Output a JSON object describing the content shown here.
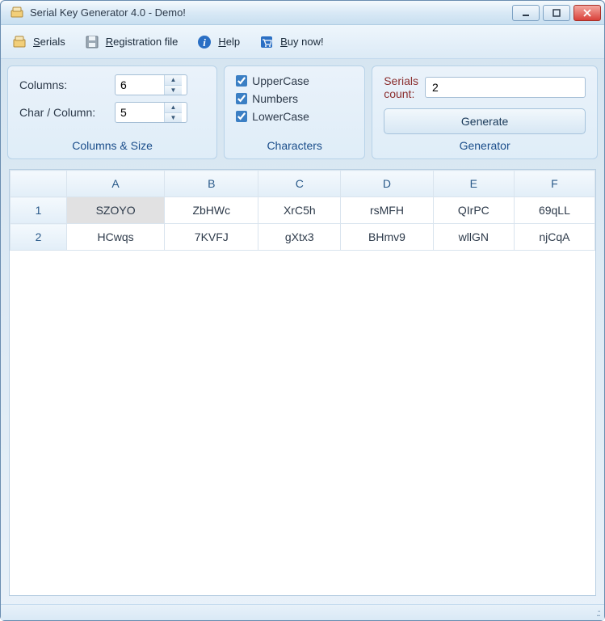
{
  "window": {
    "title": "Serial Key Generator 4.0 - Demo!"
  },
  "menu": {
    "serials": "Serials",
    "regfile": "Registration file",
    "help": "Help",
    "buynow": "Buy now!"
  },
  "panels": {
    "columns_label": "Columns:",
    "columns_value": "6",
    "charcol_label": "Char / Column:",
    "charcol_value": "5",
    "columns_size_caption": "Columns & Size",
    "uppercase": "UpperCase",
    "numbers": "Numbers",
    "lowercase": "LowerCase",
    "characters_caption": "Characters",
    "serials_count_label": "Serials count:",
    "serials_count_value": "2",
    "generate_btn": "Generate",
    "generator_caption": "Generator"
  },
  "grid": {
    "headers": [
      "A",
      "B",
      "C",
      "D",
      "E",
      "F"
    ],
    "rows": [
      {
        "num": "1",
        "cells": [
          "SZOYO",
          "ZbHWc",
          "XrC5h",
          "rsMFH",
          "QIrPC",
          "69qLL"
        ]
      },
      {
        "num": "2",
        "cells": [
          "HCwqs",
          "7KVFJ",
          "gXtx3",
          "BHmv9",
          "wllGN",
          "njCqA"
        ]
      }
    ]
  }
}
